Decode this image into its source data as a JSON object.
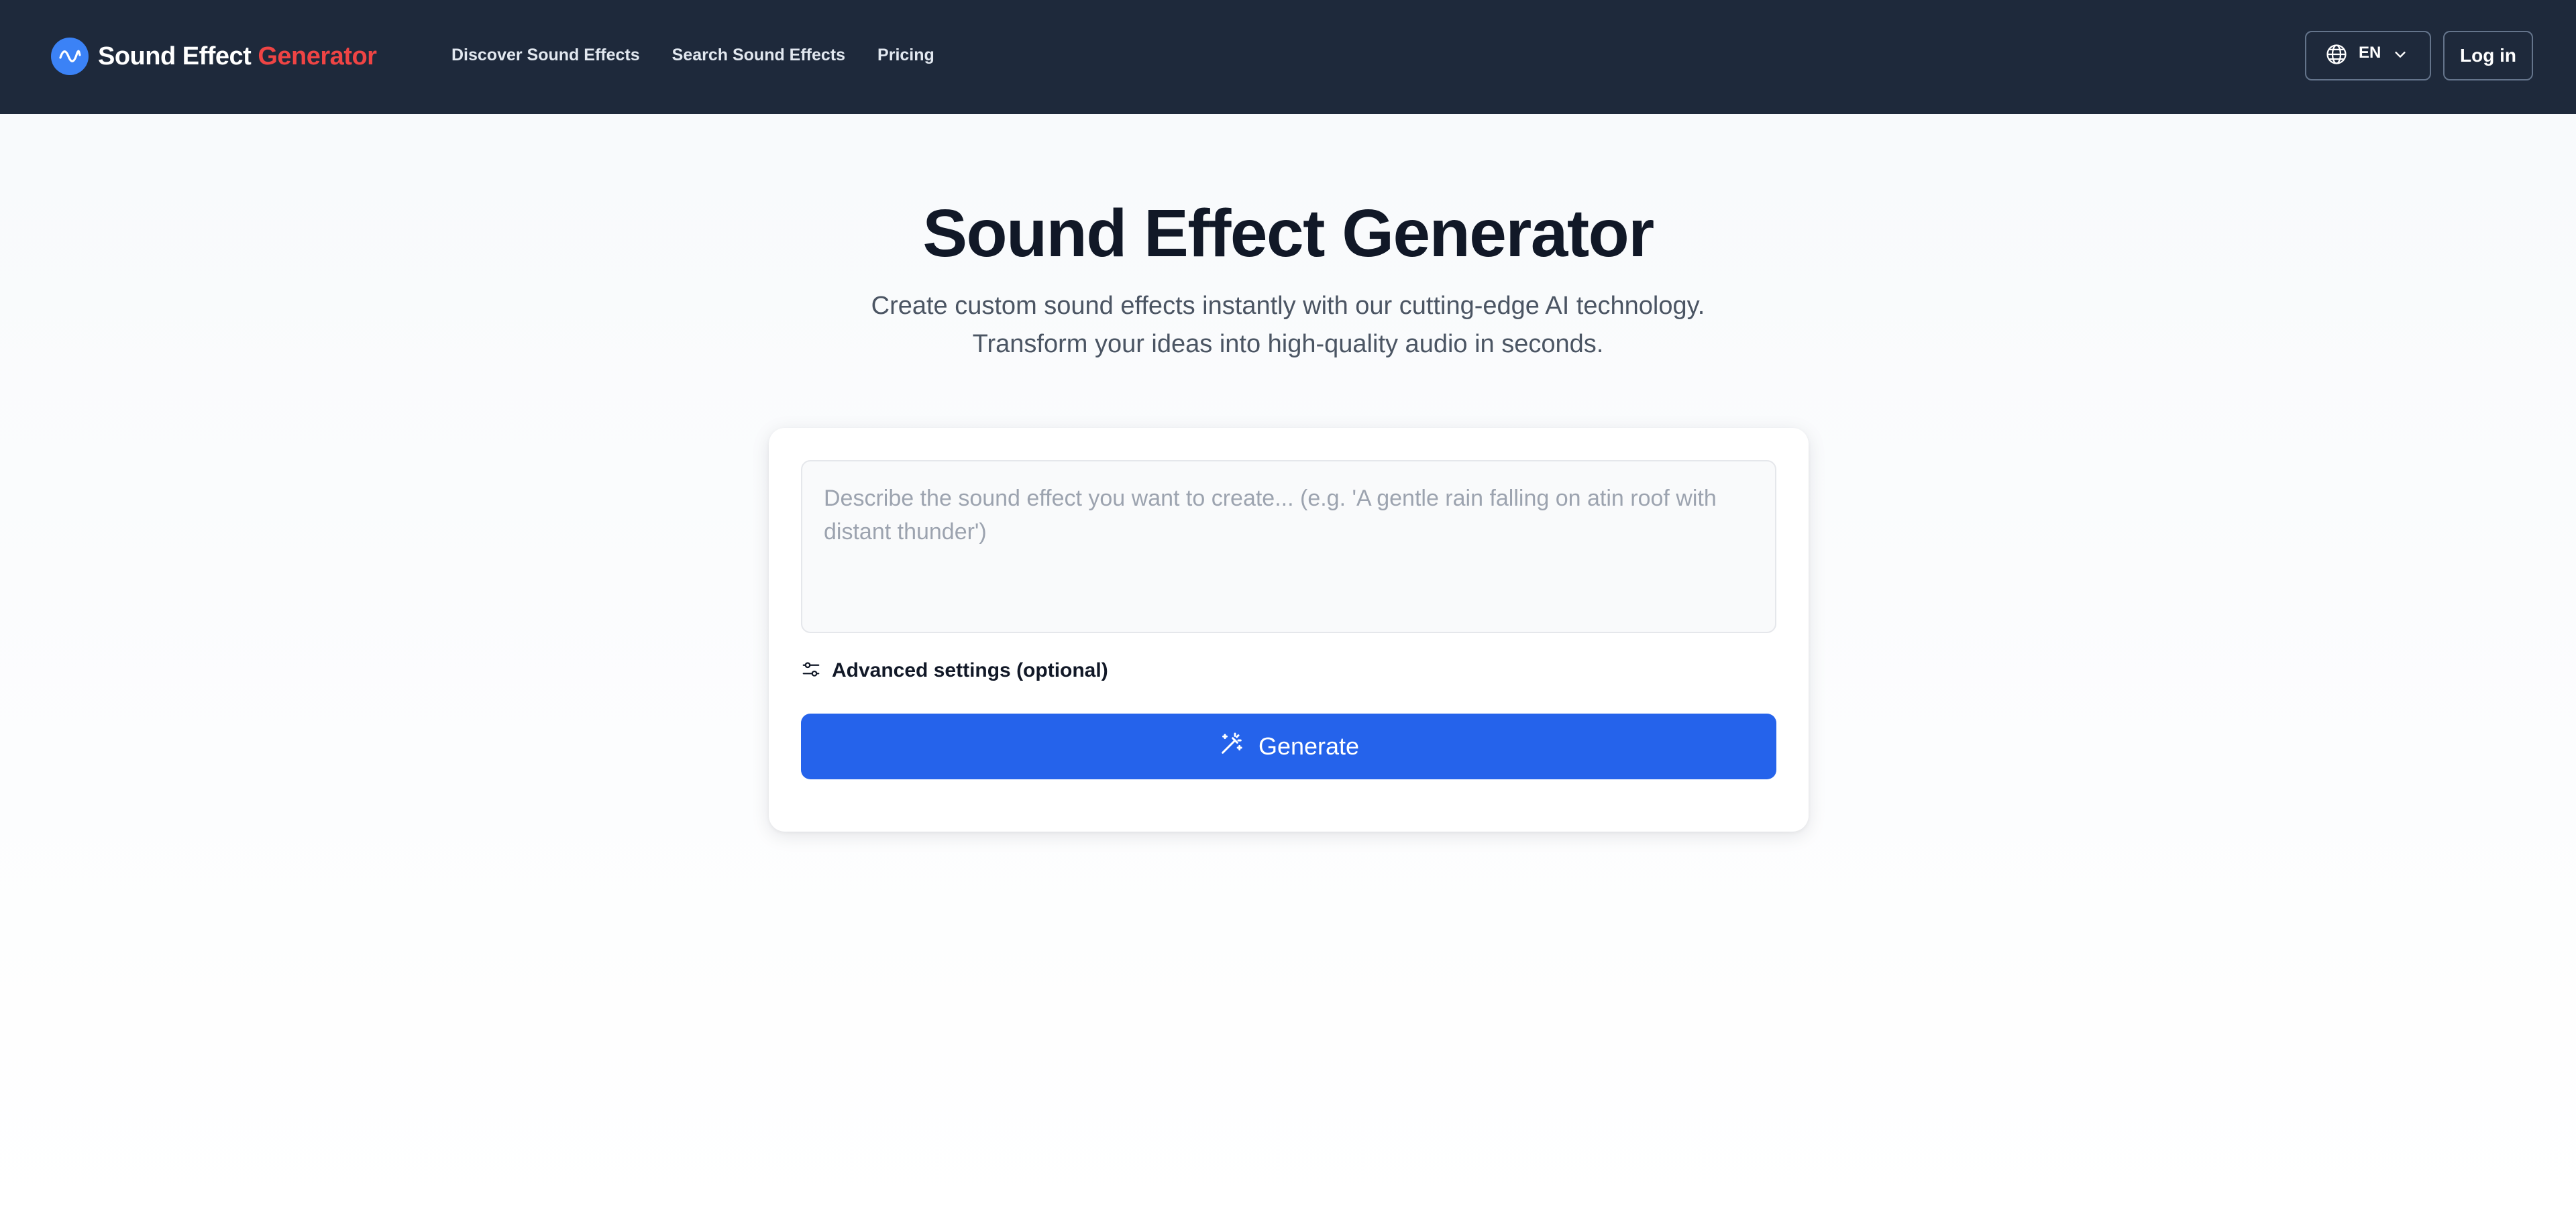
{
  "header": {
    "brand": {
      "name_primary": "Sound Effect",
      "name_accent": "Generator",
      "logo_icon": "waveform-icon"
    },
    "nav": [
      {
        "label": "Discover Sound Effects"
      },
      {
        "label": "Search Sound Effects"
      },
      {
        "label": "Pricing"
      }
    ],
    "language": {
      "icon": "globe-icon",
      "selected": "EN",
      "dropdown_icon": "chevron-down-icon"
    },
    "login_label": "Log in"
  },
  "hero": {
    "title": "Sound Effect Generator",
    "subtitle_line1": "Create custom sound effects instantly with our cutting-edge AI technology.",
    "subtitle_line2": "Transform your ideas into high-quality audio in seconds."
  },
  "generator": {
    "prompt_value": "",
    "prompt_placeholder": "Describe the sound effect you want to create... (e.g. 'A gentle rain falling on atin roof with distant thunder')",
    "advanced_label": "Advanced settings (optional)",
    "advanced_icon": "sliders-icon",
    "generate_label": "Generate",
    "generate_icon": "magic-wand-icon"
  },
  "colors": {
    "header_bg": "#1e293b",
    "brand_accent": "#ef4444",
    "primary_button": "#2563eb",
    "logo_bg": "#3b82f6"
  }
}
